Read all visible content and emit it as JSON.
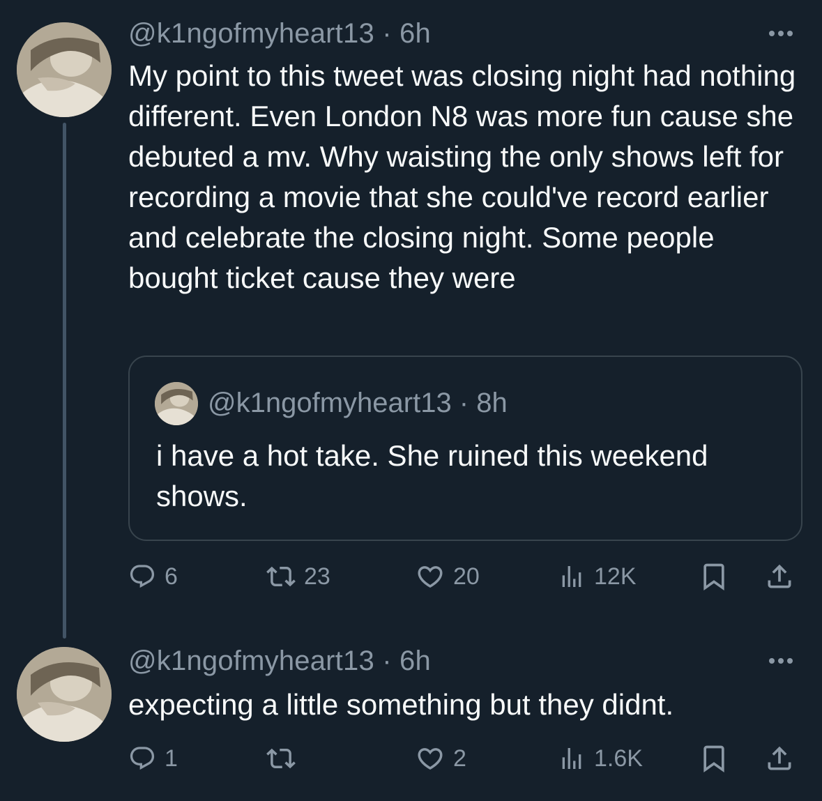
{
  "thread": [
    {
      "handle": "@k1ngofmyheart13",
      "separator": " · ",
      "time": "6h",
      "text": "My point to this tweet was closing night had nothing different. Even London N8 was more fun cause she debuted a mv. Why waisting the only shows left for recording a movie that she could've record earlier and celebrate the closing night. Some people bought ticket cause they were",
      "quote": {
        "handle": "@k1ngofmyheart13",
        "separator": " · ",
        "time": "8h",
        "text": "i have a hot take. She ruined this weekend shows."
      },
      "actions": {
        "replies": "6",
        "retweets": "23",
        "likes": "20",
        "views": "12K"
      }
    },
    {
      "handle": "@k1ngofmyheart13",
      "separator": " · ",
      "time": "6h",
      "text": "expecting a little something but they didnt.",
      "actions": {
        "replies": "1",
        "retweets": "",
        "likes": "2",
        "views": "1.6K"
      }
    }
  ],
  "icons": [
    "avatar",
    "more-icon",
    "reply-icon",
    "retweet-icon",
    "like-icon",
    "views-icon",
    "bookmark-icon",
    "share-icon"
  ],
  "colors": {
    "background": "#15202b",
    "text": "#f7f9f9",
    "muted": "#8b98a5",
    "border": "#38444d",
    "thread_line": "#425466"
  }
}
